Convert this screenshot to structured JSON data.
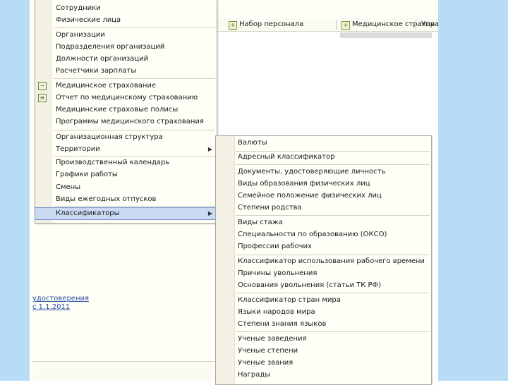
{
  "background_app": {
    "toolbar": [
      "Набор персонала",
      "Медицинское страхование",
      "Упр"
    ],
    "links": [
      "удостоверения",
      "с 1.1.2011"
    ]
  },
  "menu_main": {
    "items": [
      {
        "label": "Сотрудники"
      },
      {
        "label": "Физические лица"
      },
      {
        "label": "Организации"
      },
      {
        "label": "Подразделения организаций"
      },
      {
        "label": "Должности организаций"
      },
      {
        "label": "Расчетчики зарплаты"
      },
      {
        "label": "Медицинское страхование",
        "icon": "medical-insurance-icon"
      },
      {
        "label": "Отчет по медицинскому страхованию",
        "icon": "report-icon"
      },
      {
        "label": "Медицинские страховые полисы"
      },
      {
        "label": "Программы медицинского страхования"
      },
      {
        "label": "Организационная структура"
      },
      {
        "label": "Территории",
        "submenu": true
      },
      {
        "label": "Производственный календарь"
      },
      {
        "label": "Графики работы"
      },
      {
        "label": "Смены"
      },
      {
        "label": "Виды ежегодных отпусков"
      },
      {
        "label": "Классификаторы",
        "submenu": true,
        "selected": true
      }
    ]
  },
  "menu_classifiers": {
    "items": [
      {
        "label": "Валюты"
      },
      {
        "label": "Адресный классификатор"
      },
      {
        "label": "Документы, удостоверяющие личность"
      },
      {
        "label": "Виды образования физических лиц"
      },
      {
        "label": "Семейное положение физических лиц"
      },
      {
        "label": "Степени родства"
      },
      {
        "label": "Виды стажа"
      },
      {
        "label": "Специальности по образованию (ОКСО)"
      },
      {
        "label": "Профессии рабочих"
      },
      {
        "label": "Классификатор использования рабочего времени"
      },
      {
        "label": "Причины увольнения"
      },
      {
        "label": "Основания увольнения (статьи ТК РФ)"
      },
      {
        "label": "Классификатор стран мира"
      },
      {
        "label": "Языки народов мира"
      },
      {
        "label": "Степени знания языков"
      },
      {
        "label": "Ученые заведения"
      },
      {
        "label": "Ученые степени"
      },
      {
        "label": "Ученые звания"
      },
      {
        "label": "Награды"
      }
    ]
  },
  "colors": {
    "frame": "#b9dcf6",
    "menu_background": "#fffef7",
    "selected": "#c9daf2"
  }
}
